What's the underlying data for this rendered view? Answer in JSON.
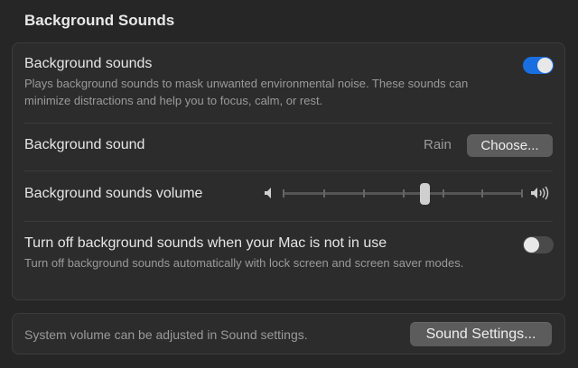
{
  "header": {
    "title": "Background Sounds"
  },
  "background_sounds": {
    "label": "Background sounds",
    "description": "Plays background sounds to mask unwanted environmental noise. These sounds can minimize distractions and help you to focus, calm, or rest.",
    "enabled": true
  },
  "sound_select": {
    "label": "Background sound",
    "current_value": "Rain",
    "button_label": "Choose..."
  },
  "volume": {
    "label": "Background sounds volume",
    "level_percent": 58,
    "min_icon": "speaker-low-icon",
    "max_icon": "speaker-high-icon"
  },
  "auto_off": {
    "label": "Turn off background sounds when your Mac is not in use",
    "description": "Turn off background sounds automatically with lock screen and screen saver modes.",
    "enabled": false
  },
  "footer": {
    "text": "System volume can be adjusted in Sound settings.",
    "button_label": "Sound Settings..."
  },
  "colors": {
    "accent": "#1a6fe0",
    "background": "#262626",
    "panel": "#2c2c2c"
  }
}
